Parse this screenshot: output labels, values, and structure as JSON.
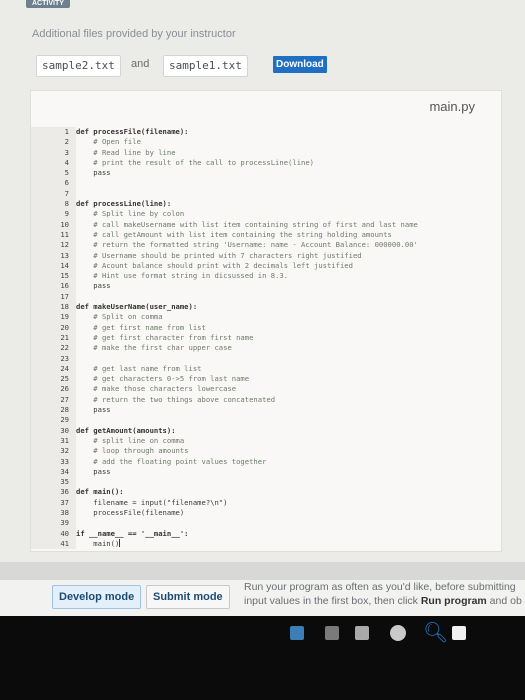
{
  "header": {
    "activity_tab": "ACTIVITY"
  },
  "files": {
    "note": "Additional files provided by your instructor",
    "file1": "sample2.txt",
    "and": "and",
    "file2": "sample1.txt",
    "download": "Download"
  },
  "editor": {
    "filename": "main.py",
    "lines": [
      "def processFile(filename):",
      "    # Open file",
      "    # Read line by line",
      "    # print the result of the call to processLine(line)",
      "    pass",
      "",
      "",
      "def processLine(line):",
      "    # Split line by colon",
      "    # call makeUsername with list item containing string of first and last name",
      "    # call getAmount with list item containing the string holding amounts",
      "    # return the formatted string 'Username: name - Account Balance: 000000.00'",
      "    # Username should be printed with 7 characters right justified",
      "    # Acount balance should print with 2 decimals left justified",
      "    # Hint use format string in dicsussed in 8.3.",
      "    pass",
      "",
      "def makeUserName(user_name):",
      "    # Split on comma",
      "    # get first name from list",
      "    # get first character from first name",
      "    # make the first char upper case",
      "",
      "    # get last name from list",
      "    # get characters 0->5 from last name",
      "    # make those characters lowercase",
      "    # return the two things above concatenated",
      "    pass",
      "",
      "def getAmount(amounts):",
      "    # split line on comma",
      "    # loop through amounts",
      "    # add the floating point values together",
      "    pass",
      "",
      "def main():",
      "    filename = input(\"filename?\\n\")",
      "    processFile(filename)",
      "",
      "if __name__ == '__main__':",
      "    main()"
    ]
  },
  "modes": {
    "develop": "Develop mode",
    "submit": "Submit mode"
  },
  "run_note": {
    "line1": "Run your program as often as you'd like, before submitting",
    "line2_a": "input values in the first box, then click ",
    "line2_bold": "Run program",
    "line2_b": " and ob"
  },
  "taskbar_icons": [
    "folder-icon",
    "media-icon",
    "document-icon",
    "browser-icon",
    "search-icon",
    "window-icon"
  ]
}
